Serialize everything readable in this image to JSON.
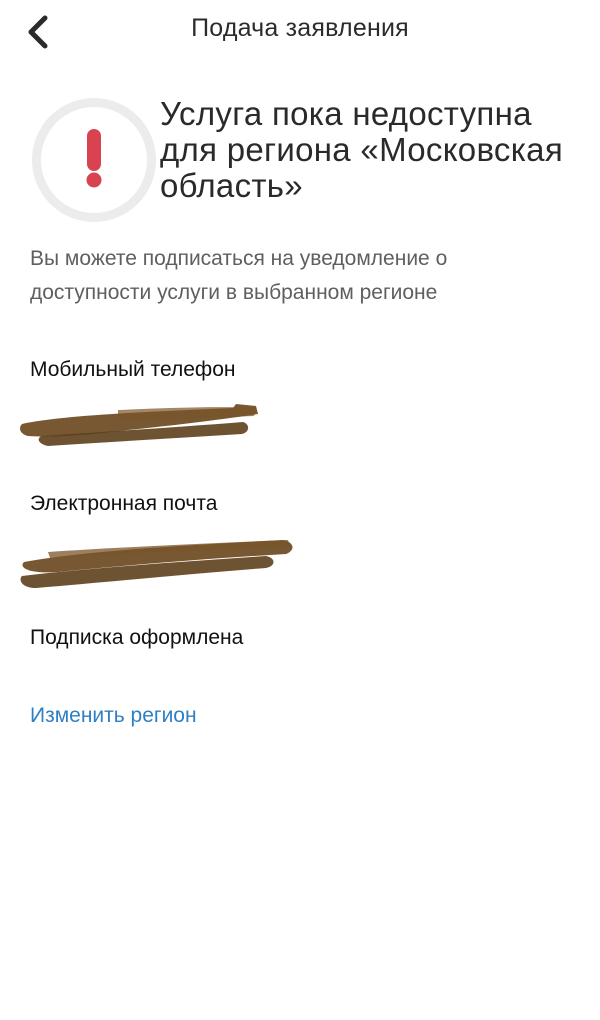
{
  "header": {
    "title": "Подача заявления",
    "back_icon": "chevron-left-icon"
  },
  "status": {
    "icon": "exclamation-icon",
    "icon_color": "#d9434f",
    "message": "Услуга пока недоступна для региона «Московская область»"
  },
  "description": "Вы можете подписаться на уведомление о доступности услуги в выбранном регионе",
  "contact": {
    "phone_label": "Мобильный телефон",
    "email_label": "Электронная почта"
  },
  "subscription_status": "Подписка оформлена",
  "change_region_label": "Изменить регион",
  "colors": {
    "link": "#2f7fc4",
    "redaction": "#6b4a22",
    "icon_ring": "#ececec"
  }
}
